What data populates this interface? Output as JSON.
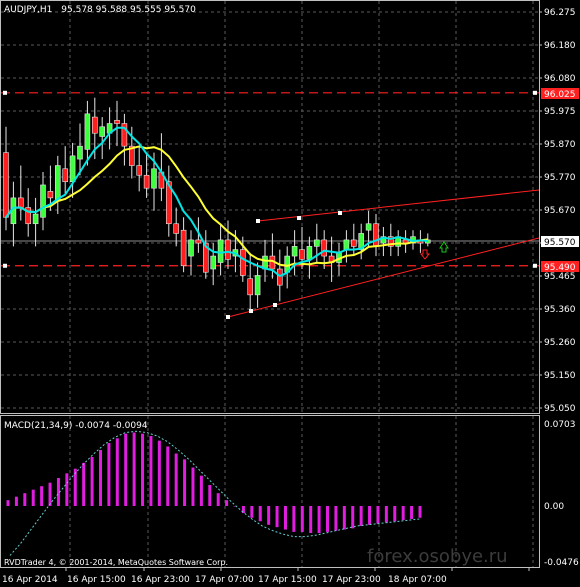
{
  "header": {
    "symbol_tf": "AUDJPY,H1",
    "ohlc": "95.578 95.588 95.555 95.570"
  },
  "macd_title": "MACD(21,34,9) -0.0074 -0.0094",
  "copyright": "RVDTrader 4, © 2001-2014, MetaQuotes Software Corp.",
  "watermark": "forex.osobye.ru",
  "price_axis": {
    "ticks": [
      "96.275",
      "96.180",
      "96.080",
      "95.975",
      "95.870",
      "95.770",
      "95.670",
      "95.570",
      "95.465",
      "95.360",
      "95.260",
      "95.150",
      "95.050"
    ],
    "current": "95.570",
    "level_upper": "96.025",
    "level_lower": "95.490"
  },
  "macd_axis": {
    "ticks": [
      "0.0703",
      "0.00",
      "-0.0476"
    ]
  },
  "time_axis": {
    "ticks": [
      "16 Apr 2014",
      "16 Apr 15:00",
      "16 Apr 23:00",
      "17 Apr 07:00",
      "17 Apr 15:00",
      "17 Apr 23:00",
      "18 Apr 07:00"
    ]
  },
  "colors": {
    "bull": "#3dff3d",
    "bear": "#ff1e1e",
    "ma_fast": "#00e5e5",
    "ma_slow": "#ffff33",
    "macd_hist": "#e01ee0",
    "signal": "#66cccc",
    "level": "#ff2020",
    "trend": "#ff2020",
    "arrow_up": "#19c819",
    "arrow_down": "#ff2020"
  },
  "chart_data": {
    "type": "candlestick",
    "timeframe": "H1",
    "ylim": [
      95.0,
      96.32
    ],
    "candles": [
      [
        95.84,
        95.92,
        95.6,
        95.64
      ],
      [
        95.62,
        95.75,
        95.55,
        95.7
      ],
      [
        95.7,
        95.8,
        95.63,
        95.67
      ],
      [
        95.67,
        95.73,
        95.58,
        95.62
      ],
      [
        95.62,
        95.7,
        95.55,
        95.65
      ],
      [
        95.64,
        95.78,
        95.6,
        95.74
      ],
      [
        95.72,
        95.8,
        95.66,
        95.7
      ],
      [
        95.69,
        95.83,
        95.65,
        95.8
      ],
      [
        95.79,
        95.86,
        95.71,
        95.75
      ],
      [
        95.75,
        95.87,
        95.7,
        95.83
      ],
      [
        95.82,
        95.93,
        95.77,
        95.86
      ],
      [
        95.85,
        96.0,
        95.8,
        95.96
      ],
      [
        95.95,
        96.01,
        95.82,
        95.9
      ],
      [
        95.89,
        95.95,
        95.82,
        95.92
      ],
      [
        95.9,
        95.98,
        95.85,
        95.93
      ],
      [
        95.94,
        96.0,
        95.86,
        95.93
      ],
      [
        95.93,
        95.96,
        95.8,
        95.86
      ],
      [
        95.86,
        95.92,
        95.76,
        95.8
      ],
      [
        95.8,
        95.86,
        95.72,
        95.77
      ],
      [
        95.77,
        95.84,
        95.7,
        95.73
      ],
      [
        95.73,
        95.84,
        95.66,
        95.79
      ],
      [
        95.78,
        95.9,
        95.69,
        95.73
      ],
      [
        95.75,
        95.8,
        95.58,
        95.62
      ],
      [
        95.62,
        95.67,
        95.55,
        95.59
      ],
      [
        95.6,
        95.64,
        95.47,
        95.49
      ],
      [
        95.52,
        95.6,
        95.46,
        95.57
      ],
      [
        95.57,
        95.64,
        95.53,
        95.56
      ],
      [
        95.56,
        95.6,
        95.45,
        95.47
      ],
      [
        95.48,
        95.56,
        95.43,
        95.52
      ],
      [
        95.5,
        95.62,
        95.46,
        95.57
      ],
      [
        95.57,
        95.63,
        95.48,
        95.51
      ],
      [
        95.52,
        95.6,
        95.47,
        95.54
      ],
      [
        95.54,
        95.58,
        95.44,
        95.46
      ],
      [
        95.45,
        95.53,
        95.35,
        95.4
      ],
      [
        95.4,
        95.5,
        95.36,
        95.46
      ],
      [
        95.48,
        95.57,
        95.44,
        95.52
      ],
      [
        95.52,
        95.59,
        95.45,
        95.48
      ],
      [
        95.48,
        95.54,
        95.38,
        95.43
      ],
      [
        95.47,
        95.55,
        95.42,
        95.52
      ],
      [
        95.52,
        95.6,
        95.46,
        95.55
      ],
      [
        95.54,
        95.61,
        95.48,
        95.51
      ],
      [
        95.51,
        95.58,
        95.45,
        95.55
      ],
      [
        95.55,
        95.62,
        95.5,
        95.57
      ],
      [
        95.57,
        95.6,
        95.48,
        95.52
      ],
      [
        95.52,
        95.58,
        95.44,
        95.5
      ],
      [
        95.5,
        95.56,
        95.46,
        95.53
      ],
      [
        95.54,
        95.6,
        95.5,
        95.57
      ],
      [
        95.57,
        95.62,
        95.52,
        95.55
      ],
      [
        95.54,
        95.62,
        95.51,
        95.59
      ],
      [
        95.6,
        95.66,
        95.55,
        95.62
      ],
      [
        95.62,
        95.65,
        95.52,
        95.55
      ],
      [
        95.56,
        95.61,
        95.52,
        95.58
      ],
      [
        95.58,
        95.62,
        95.52,
        95.55
      ],
      [
        95.55,
        95.6,
        95.52,
        95.58
      ],
      [
        95.57,
        95.6,
        95.53,
        95.56
      ],
      [
        95.56,
        95.6,
        95.54,
        95.58
      ],
      [
        95.57,
        95.6,
        95.53,
        95.56
      ],
      [
        95.56,
        95.59,
        95.55,
        95.57
      ]
    ],
    "levels": [
      96.025,
      95.49
    ],
    "trendlines": [
      [
        [
          95.625,
          95.645,
          95.68
        ],
        [
          95.72
        ]
      ],
      [
        [
          95.34,
          95.36,
          95.37
        ],
        [
          95.57
        ]
      ]
    ],
    "macd": {
      "range": [
        -0.0476,
        0.0703
      ],
      "hist": [
        0.005,
        0.008,
        0.011,
        0.014,
        0.017,
        0.02,
        0.024,
        0.028,
        0.032,
        0.037,
        0.042,
        0.048,
        0.054,
        0.058,
        0.062,
        0.063,
        0.062,
        0.06,
        0.056,
        0.051,
        0.045,
        0.04,
        0.033,
        0.026,
        0.018,
        0.011,
        0.005,
        0,
        -0.006,
        -0.01,
        -0.013,
        -0.016,
        -0.018,
        -0.02,
        -0.022,
        -0.022,
        -0.023,
        -0.023,
        -0.022,
        -0.021,
        -0.02,
        -0.019,
        -0.017,
        -0.016,
        -0.015,
        -0.014,
        -0.013,
        -0.012,
        -0.011,
        -0.01
      ],
      "signal": [
        -0.042,
        -0.032,
        -0.02,
        -0.008,
        0.004,
        0.015,
        0.026,
        0.036,
        0.045,
        0.053,
        0.059,
        0.063,
        0.064,
        0.063,
        0.06,
        0.055,
        0.048,
        0.04,
        0.031,
        0.022,
        0.013,
        0.004,
        -0.004,
        -0.011,
        -0.017,
        -0.021,
        -0.024,
        -0.026,
        -0.026,
        -0.025,
        -0.023,
        -0.021,
        -0.019,
        -0.017,
        -0.016,
        -0.015,
        -0.014,
        -0.013,
        -0.012,
        -0.011
      ]
    }
  }
}
